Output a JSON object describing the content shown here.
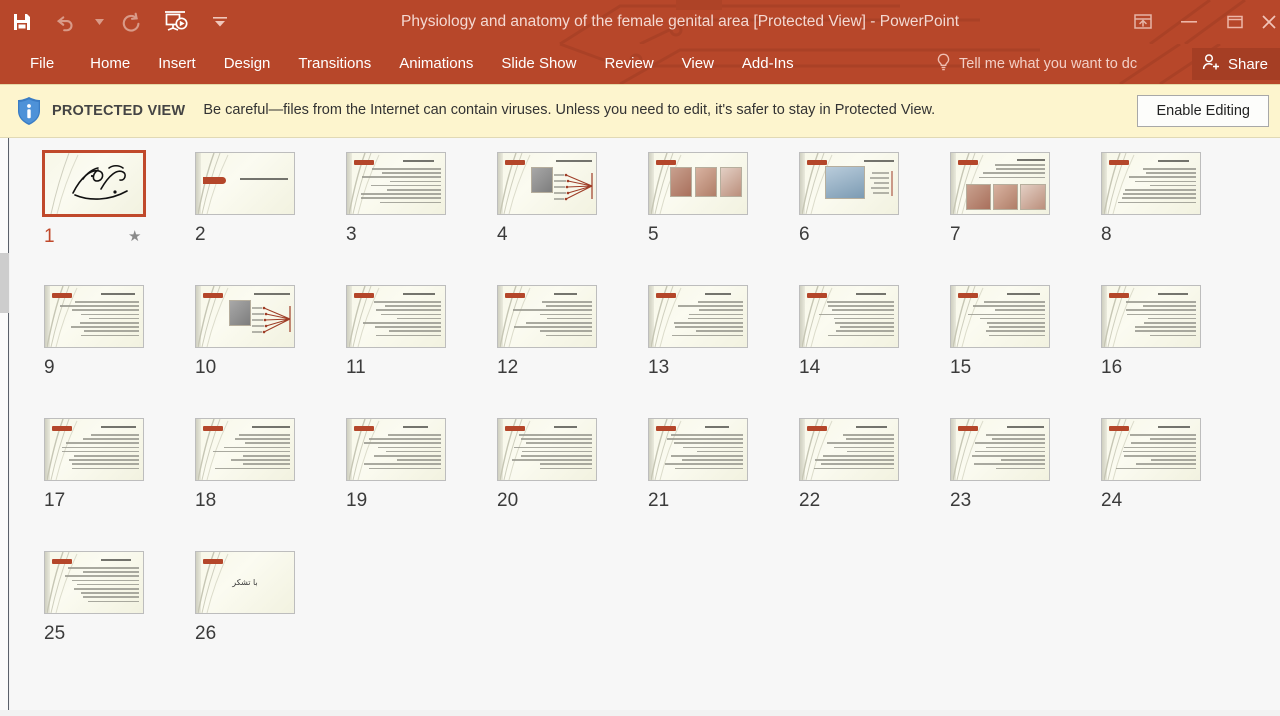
{
  "window": {
    "title": "Physiology and anatomy of the female genital area [Protected View] - PowerPoint",
    "accent_color": "#b7472a",
    "share_bg": "#a53e24"
  },
  "quick_access": {
    "items": [
      {
        "name": "save-button",
        "label": "Save"
      },
      {
        "name": "undo-button",
        "label": "Undo"
      },
      {
        "name": "undo-dropdown",
        "label": "Undo options"
      },
      {
        "name": "redo-button",
        "label": "Redo"
      },
      {
        "name": "start-from-beginning-button",
        "label": "Start From Beginning"
      },
      {
        "name": "customize-qat-button",
        "label": "Customize Quick Access Toolbar"
      }
    ]
  },
  "window_controls": [
    {
      "name": "ribbon-display-options-button",
      "label": "Ribbon Display Options"
    },
    {
      "name": "minimize-button",
      "label": "Minimize"
    },
    {
      "name": "maximize-button",
      "label": "Restore Down"
    },
    {
      "name": "close-button",
      "label": "Close"
    }
  ],
  "ribbon": {
    "tabs": [
      {
        "label": "File",
        "name": "tab-file"
      },
      {
        "label": "Home",
        "name": "tab-home"
      },
      {
        "label": "Insert",
        "name": "tab-insert"
      },
      {
        "label": "Design",
        "name": "tab-design"
      },
      {
        "label": "Transitions",
        "name": "tab-transitions"
      },
      {
        "label": "Animations",
        "name": "tab-animations"
      },
      {
        "label": "Slide Show",
        "name": "tab-slide-show"
      },
      {
        "label": "Review",
        "name": "tab-review"
      },
      {
        "label": "View",
        "name": "tab-view"
      },
      {
        "label": "Add-Ins",
        "name": "tab-add-ins"
      }
    ],
    "tell_me": "Tell me what you want to dc",
    "share_label": "Share"
  },
  "protected_view": {
    "badge": "PROTECTED VIEW",
    "message": "Be careful—files from the Internet can contain viruses. Unless you need to edit, it's safer to stay in Protected View.",
    "button": "Enable Editing",
    "bg_color": "#fdf5ce"
  },
  "slide_sorter": {
    "selected_slide": 1,
    "slides": [
      {
        "number": "1",
        "kind": "calligraphy",
        "text": "بسم الله الرحمن الرحيم",
        "has_animation": true
      },
      {
        "number": "2",
        "kind": "title-only",
        "text": "فیزیولوژی و آناتومی ناحیه تناسلی زنان",
        "has_animation": false
      },
      {
        "number": "3",
        "kind": "text",
        "text": "دستگاه تناسلی زن",
        "has_animation": false
      },
      {
        "number": "4",
        "kind": "diagram",
        "text": "اعضای تناسلی خارجی",
        "has_animation": false
      },
      {
        "number": "5",
        "kind": "three-images",
        "text": "",
        "has_animation": false
      },
      {
        "number": "6",
        "kind": "image-left",
        "text": "اعضای تناسلی داخلی",
        "has_animation": false
      },
      {
        "number": "7",
        "kind": "images-text",
        "text": "",
        "has_animation": false
      },
      {
        "number": "8",
        "kind": "text",
        "text": "",
        "has_animation": false
      },
      {
        "number": "9",
        "kind": "text",
        "text": "رباط های نگهدارنده رحم",
        "has_animation": false
      },
      {
        "number": "10",
        "kind": "diagram",
        "text": "uterine tubes",
        "has_animation": false
      },
      {
        "number": "11",
        "kind": "text",
        "text": "",
        "has_animation": false
      },
      {
        "number": "12",
        "kind": "text",
        "text": "",
        "has_animation": false
      },
      {
        "number": "13",
        "kind": "text",
        "text": "",
        "has_animation": false
      },
      {
        "number": "14",
        "kind": "text",
        "text": "",
        "has_animation": false
      },
      {
        "number": "15",
        "kind": "text",
        "text": "",
        "has_animation": false
      },
      {
        "number": "16",
        "kind": "text",
        "text": "",
        "has_animation": false
      },
      {
        "number": "17",
        "kind": "text",
        "text": "",
        "has_animation": false
      },
      {
        "number": "18",
        "kind": "text",
        "text": "",
        "has_animation": false
      },
      {
        "number": "19",
        "kind": "text",
        "text": "",
        "has_animation": false
      },
      {
        "number": "20",
        "kind": "text",
        "text": "",
        "has_animation": false
      },
      {
        "number": "21",
        "kind": "text",
        "text": "",
        "has_animation": false
      },
      {
        "number": "22",
        "kind": "text",
        "text": "",
        "has_animation": false
      },
      {
        "number": "23",
        "kind": "text",
        "text": "",
        "has_animation": false
      },
      {
        "number": "24",
        "kind": "text",
        "text": "",
        "has_animation": false
      },
      {
        "number": "25",
        "kind": "text",
        "text": "",
        "has_animation": false
      },
      {
        "number": "26",
        "kind": "thanks",
        "text": "با تشکر",
        "has_animation": false
      }
    ]
  }
}
